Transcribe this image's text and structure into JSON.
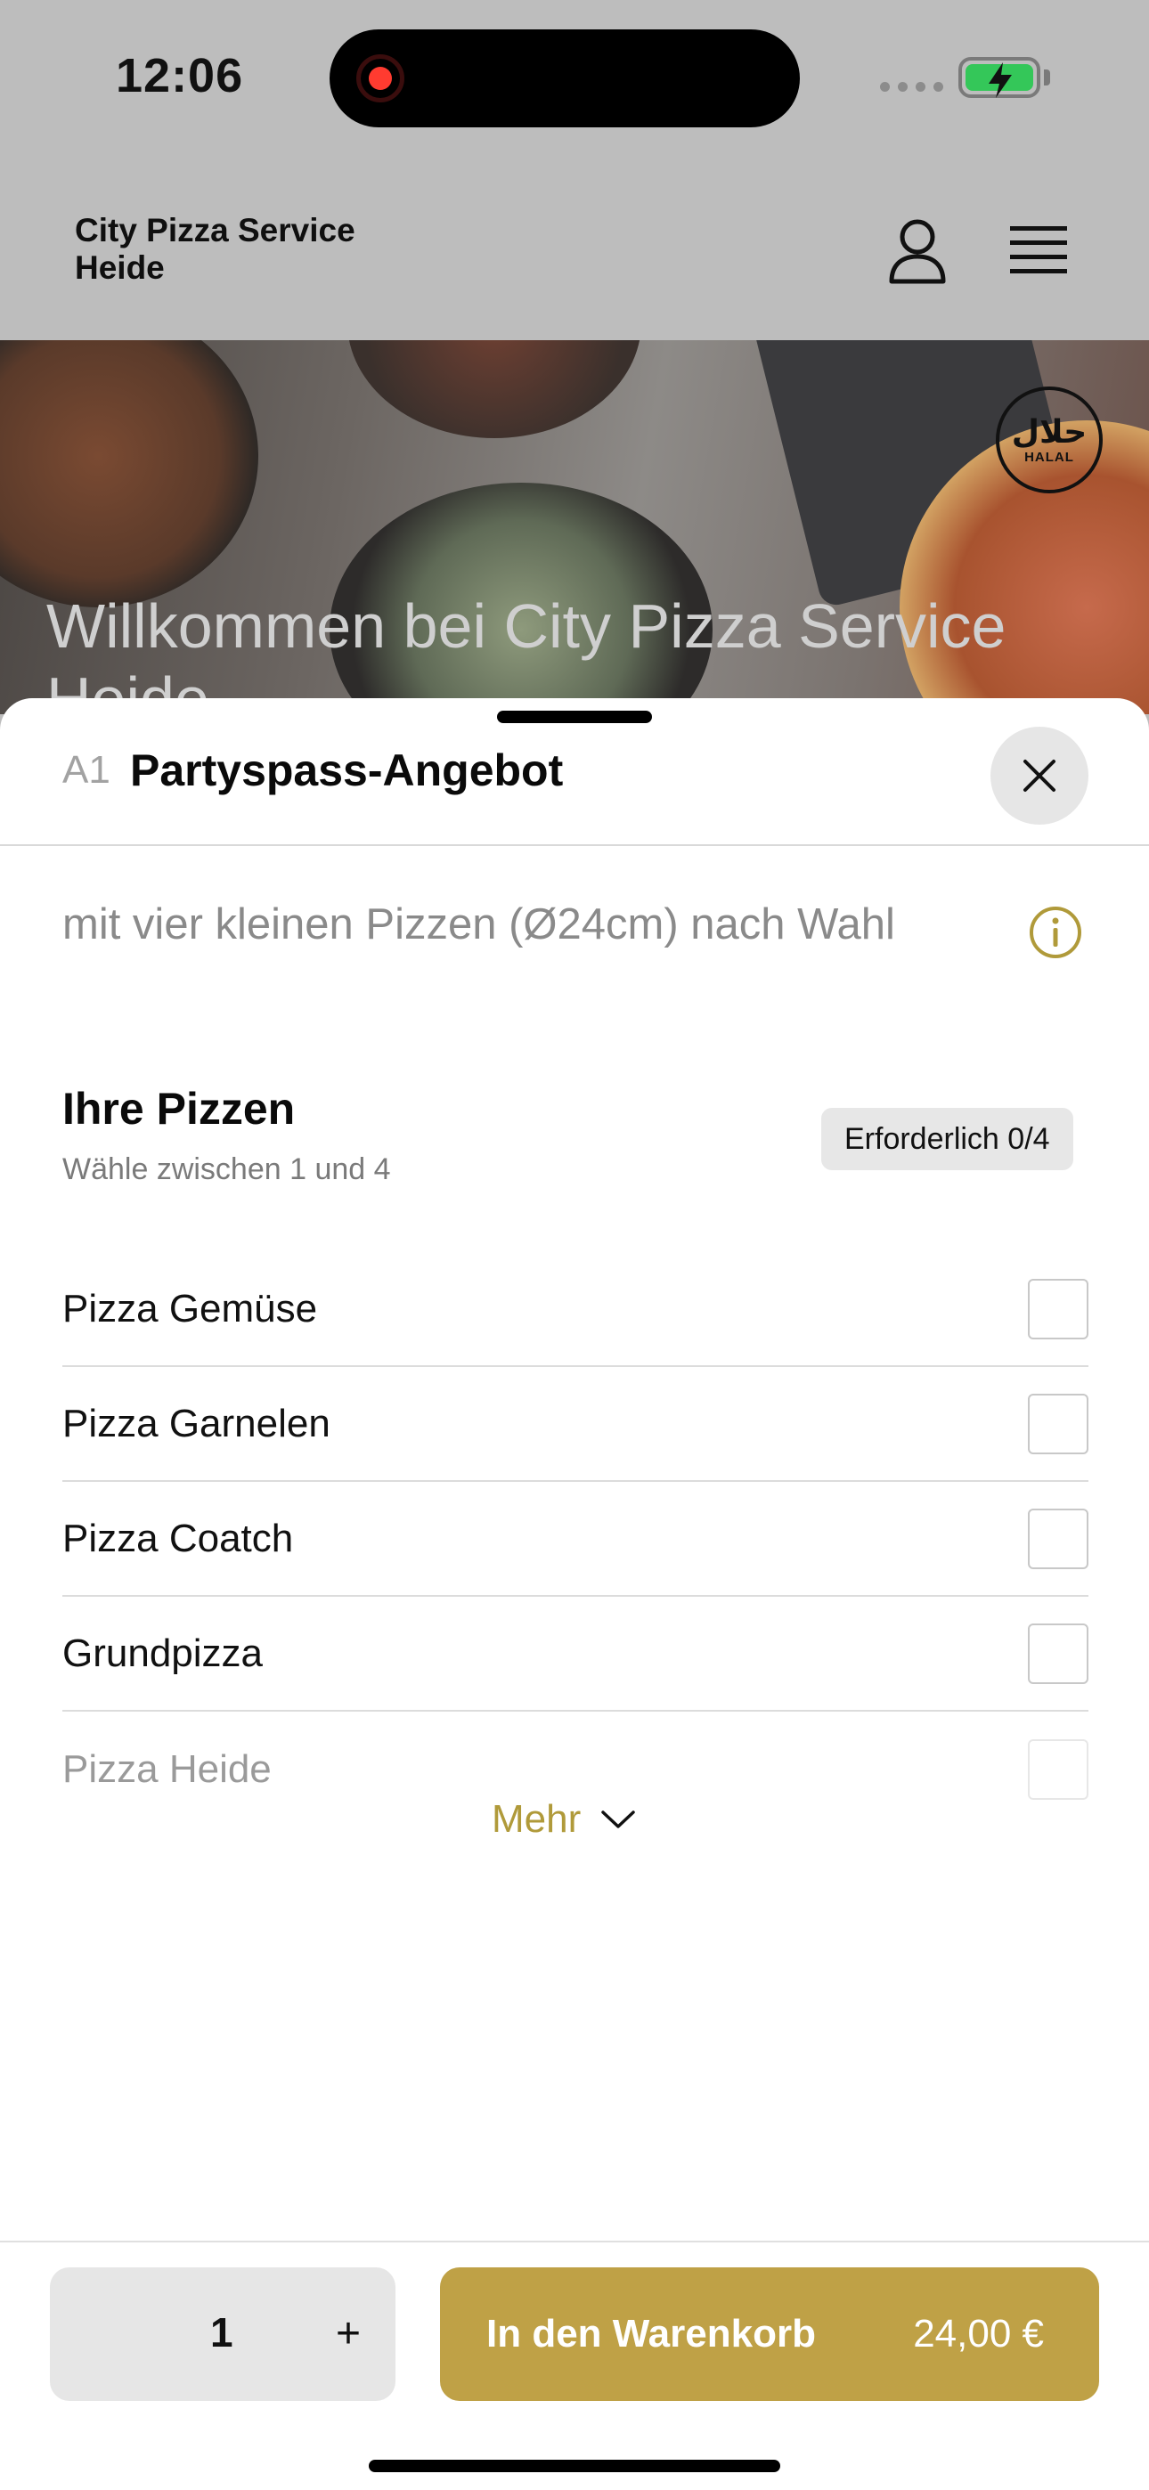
{
  "status_bar": {
    "time": "12:06"
  },
  "header": {
    "brand": "City Pizza Service Heide"
  },
  "hero": {
    "badge_arabic": "حلال",
    "badge_text": "HALAL",
    "title": "Willkommen bei City Pizza Service Heide"
  },
  "sheet": {
    "item_code": "A1",
    "item_title": "Partyspass-Angebot",
    "description": "mit vier kleinen Pizzen (Ø24cm) nach Wahl",
    "group": {
      "title": "Ihre Pizzen",
      "subtitle": "Wähle zwischen 1 und 4",
      "required_label": "Erforderlich 0/4",
      "options": [
        {
          "label": "Pizza Gemüse"
        },
        {
          "label": "Pizza Garnelen"
        },
        {
          "label": "Pizza Coatch"
        },
        {
          "label": "Grundpizza"
        },
        {
          "label": "Pizza Heide"
        }
      ]
    },
    "more_label": "Mehr"
  },
  "footer": {
    "quantity": "1",
    "plus_label": "+",
    "cart_label": "In den Warenkorb",
    "price": "24,00 €"
  },
  "colors": {
    "accent": "#bfa146",
    "overlay": "#bdbdbd",
    "battery": "#34c759",
    "record": "#ff3b30"
  }
}
